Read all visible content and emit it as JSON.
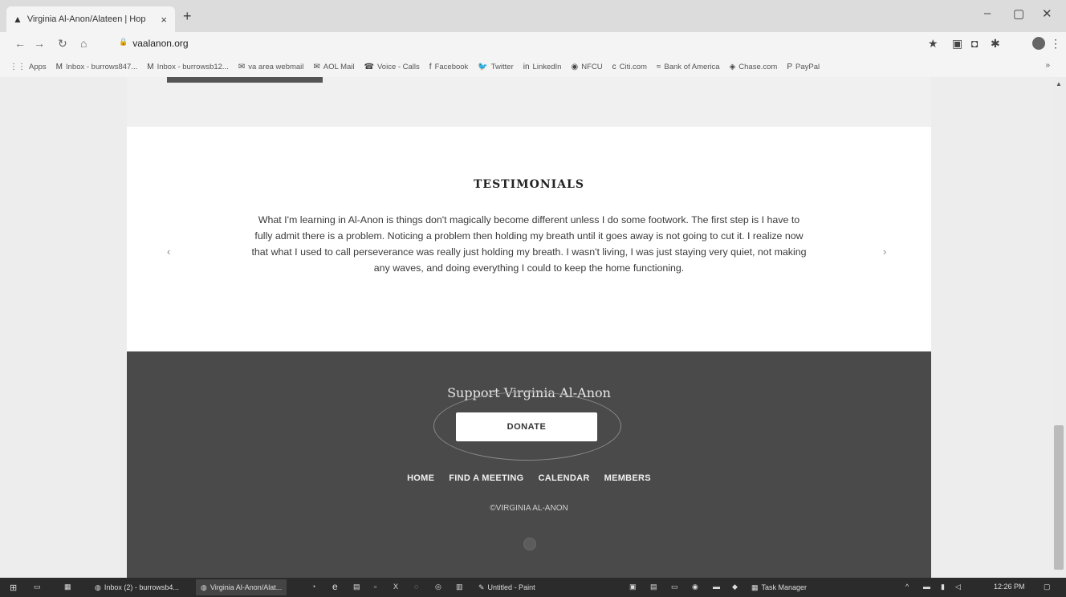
{
  "browser": {
    "tab_title": "Virginia Al-Anon/Alateen | Hop",
    "tab_close": "×",
    "new_tab": "+",
    "url": "vaalanon.org",
    "lock": "🔒"
  },
  "bookmarks": [
    {
      "label": "Apps",
      "icon": "apps-grid-icon",
      "glyph": "⋮⋮"
    },
    {
      "label": "Inbox - burrows847...",
      "icon": "gmail-icon",
      "glyph": "M"
    },
    {
      "label": "Inbox - burrowsb12...",
      "icon": "gmail-icon",
      "glyph": "M"
    },
    {
      "label": "va area webmail",
      "icon": "webmail-icon",
      "glyph": "✉"
    },
    {
      "label": "AOL Mail",
      "icon": "aol-icon",
      "glyph": "✉"
    },
    {
      "label": "Voice - Calls",
      "icon": "voice-icon",
      "glyph": "☎"
    },
    {
      "label": "Facebook",
      "icon": "facebook-icon",
      "glyph": "f"
    },
    {
      "label": "Twitter",
      "icon": "twitter-icon",
      "glyph": "🐦"
    },
    {
      "label": "LinkedIn",
      "icon": "linkedin-icon",
      "glyph": "in"
    },
    {
      "label": "NFCU",
      "icon": "nfcu-icon",
      "glyph": "◉"
    },
    {
      "label": "Citi.com",
      "icon": "citi-icon",
      "glyph": "c"
    },
    {
      "label": "Bank of America",
      "icon": "boa-icon",
      "glyph": "≈"
    },
    {
      "label": "Chase.com",
      "icon": "chase-icon",
      "glyph": "◈"
    },
    {
      "label": "PayPal",
      "icon": "paypal-icon",
      "glyph": "P"
    }
  ],
  "bookmarks_more": "»",
  "testimonials": {
    "title": "TESTIMONIALS",
    "quote": "What I'm learning in Al-Anon is things don't magically become different unless I do some footwork. The first step is I have to fully admit there is a problem. Noticing a problem then holding my breath until it goes away is not going to cut it. I realize now that what I used to call perseverance was really just holding my breath. I wasn't living, I was just staying very quiet, not making any waves, and doing everything I could to keep the home functioning.",
    "prev": "‹",
    "next": "›"
  },
  "footer": {
    "support_title": "Support Virginia Al-Anon",
    "donate_label": "DONATE",
    "nav": [
      "HOME",
      "FIND A MEETING",
      "CALENDAR",
      "MEMBERS"
    ],
    "copyright": "©VIRGINIA AL-ANON"
  },
  "taskbar": {
    "items": [
      "Inbox (2) - burrowsb4...",
      "Virginia Al-Anon/Alat...",
      "Untitled - Paint",
      "Task Manager"
    ],
    "time": "12:26 PM"
  },
  "colors": {
    "footer_bg": "#4a4a4a",
    "page_bg": "#ffffff",
    "chrome_bg": "#f4f4f4"
  }
}
